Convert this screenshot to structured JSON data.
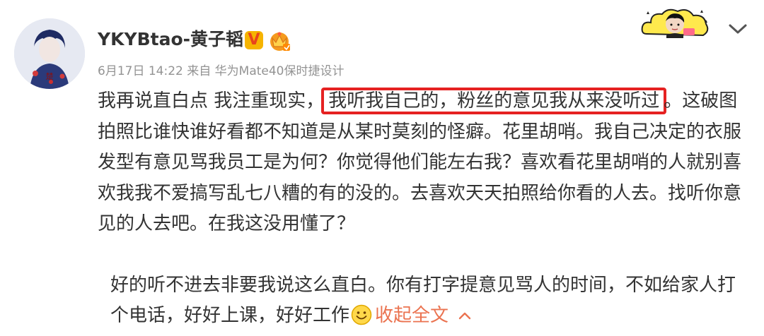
{
  "post": {
    "username": "YKYBtao-黄子韬",
    "verified_badge": "V",
    "meta": "6月17日 14:22 来自 华为Mate40保时捷设计",
    "paragraph1_before": "我再说直白点 我注重现实，",
    "paragraph1_highlight": "我听我自己的，粉丝的意见我从来没听过",
    "paragraph1_after": "。这破图拍照比谁快谁好看都不知道是从某时莫刻的怪癖。花里胡哨。我自己决定的衣服发型有意见骂我员工是为何？你觉得他们能左右我？喜欢看花里胡哨的人就别喜欢我我不爱搞写乱七八糟的有的没的。去喜欢天天拍照给你看的人去。找听你意见的人去吧。在我这没用懂了？",
    "paragraph2": "好的听不进去非要我说这么直白。你有打字提意见骂人的时间，不如给家人打个电话，好好上课，好好工作",
    "collapse_label": "收起全文"
  },
  "icons": {
    "avatar": "avatar-image",
    "verified": "verified-v-icon",
    "crown": "crown-membership-icon",
    "sticker": "cloud-sticker-decoration",
    "more": "chevron-down-icon",
    "emoji": "smile-emoji-icon",
    "collapse": "chevron-up-icon"
  },
  "colors": {
    "text": "#333333",
    "meta": "#939393",
    "highlight_box": "#e52222",
    "link": "#eb7350",
    "vbadge_bg": "#f6b400"
  }
}
